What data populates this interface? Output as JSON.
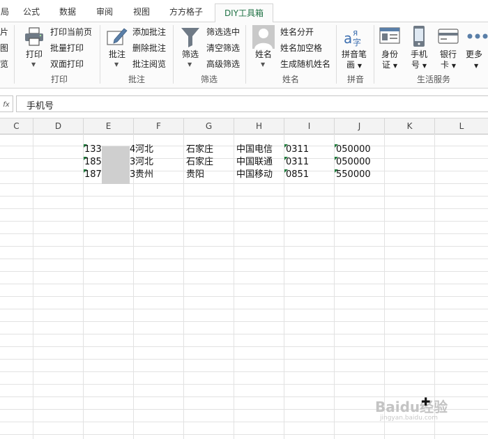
{
  "tabs": [
    {
      "label": "局",
      "active": false
    },
    {
      "label": "公式",
      "active": false
    },
    {
      "label": "数据",
      "active": false
    },
    {
      "label": "审阅",
      "active": false
    },
    {
      "label": "视图",
      "active": false
    },
    {
      "label": "方方格子",
      "active": false
    },
    {
      "label": "DIY工具箱",
      "active": true
    }
  ],
  "ribbon": {
    "cut_left": [
      "片",
      "图",
      "览"
    ],
    "print": {
      "big": "打印",
      "items": [
        "打印当前页",
        "批量打印",
        "双面打印"
      ],
      "label": "打印"
    },
    "comment": {
      "big": "批注",
      "items": [
        "添加批注",
        "删除批注",
        "批注阅览"
      ],
      "label": "批注"
    },
    "filter": {
      "big": "筛选",
      "items": [
        "筛选选中",
        "清空筛选",
        "高级筛选"
      ],
      "label": "筛选"
    },
    "name": {
      "big": "姓名",
      "items": [
        "姓名分开",
        "姓名加空格",
        "生成随机姓名"
      ],
      "label": "姓名"
    },
    "pinyin": {
      "big1": "拼音笔",
      "big2": "画",
      "label": "拼音"
    },
    "life": {
      "b1a": "身份",
      "b1b": "证",
      "b2a": "手机",
      "b2b": "号",
      "b3a": "银行",
      "b3b": "卡",
      "b4a": "更多",
      "label": "生活服务"
    }
  },
  "formula_bar": {
    "fx": "fx",
    "value": "手机号"
  },
  "columns": [
    "C",
    "D",
    "E",
    "F",
    "G",
    "H",
    "I",
    "J",
    "K",
    "L"
  ],
  "rows": [
    {
      "e1": "133",
      "e2": "4",
      "f": "河北",
      "g": "石家庄",
      "h": "中国电信",
      "i": "0311",
      "j": "050000"
    },
    {
      "e1": "185",
      "e2": "3",
      "f": "河北",
      "g": "石家庄",
      "h": "中国联通",
      "i": "0311",
      "j": "050000"
    },
    {
      "e1": "187",
      "e2": "3",
      "f": "贵州",
      "g": "贵阳",
      "h": "中国移动",
      "i": "0851",
      "j": "550000"
    }
  ],
  "watermark": "Baidu经验",
  "watermark_url": "jingyan.baidu.com",
  "colors": {
    "accent": "#217346",
    "comment_indicator": "#1d7b3a"
  }
}
